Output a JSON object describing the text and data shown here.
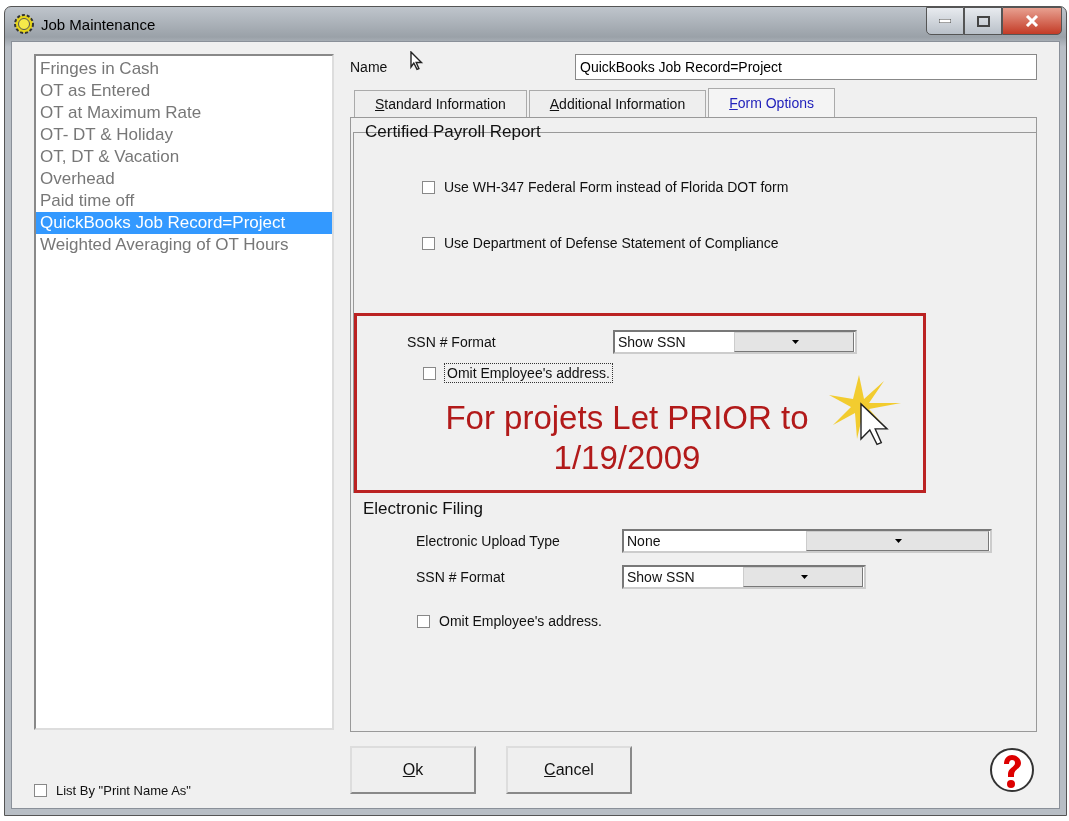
{
  "window": {
    "title": "Job Maintenance"
  },
  "list": {
    "items": [
      {
        "label": "Fringes in Cash",
        "selected": false
      },
      {
        "label": "OT as Entered",
        "selected": false
      },
      {
        "label": "OT at Maximum Rate",
        "selected": false
      },
      {
        "label": "OT- DT & Holiday",
        "selected": false
      },
      {
        "label": "OT, DT & Vacation",
        "selected": false
      },
      {
        "label": "Overhead",
        "selected": false
      },
      {
        "label": "Paid time off",
        "selected": false
      },
      {
        "label": "QuickBooks Job Record=Project",
        "selected": true
      },
      {
        "label": "Weighted Averaging of OT Hours",
        "selected": false
      }
    ]
  },
  "list_by_print_name": {
    "label": "List By \"Print Name As\"",
    "checked": false
  },
  "name": {
    "label": "Name",
    "value": "QuickBooks Job Record=Project"
  },
  "tabs": [
    {
      "label": "Standard Information",
      "selected": false
    },
    {
      "label": "Additional Information",
      "selected": false
    },
    {
      "label": "Form Options",
      "selected": true
    }
  ],
  "certified_payroll": {
    "title": "Certified Payroll Report",
    "options": [
      {
        "label": "Use WH-347 Federal Form instead of Florida DOT form",
        "checked": false
      },
      {
        "label": "Use Department of Defense Statement of Compliance",
        "checked": false
      }
    ],
    "ssn_format": {
      "label": "SSN # Format",
      "value": "Show SSN"
    },
    "omit_address": {
      "label": "Omit Employee's address.",
      "checked": false,
      "focused": true
    }
  },
  "callout": {
    "text": "For projets Let PRIOR to 1/19/2009"
  },
  "electronic_filing": {
    "title": "Electronic Filing",
    "upload_type": {
      "label": "Electronic Upload Type",
      "value": "None"
    },
    "ssn_format": {
      "label": "SSN # Format",
      "value": "Show SSN"
    },
    "omit_address": {
      "label": "Omit Employee's address.",
      "checked": false,
      "focused": false
    }
  },
  "buttons": [
    {
      "label": "Ok"
    },
    {
      "label": "Cancel"
    }
  ]
}
